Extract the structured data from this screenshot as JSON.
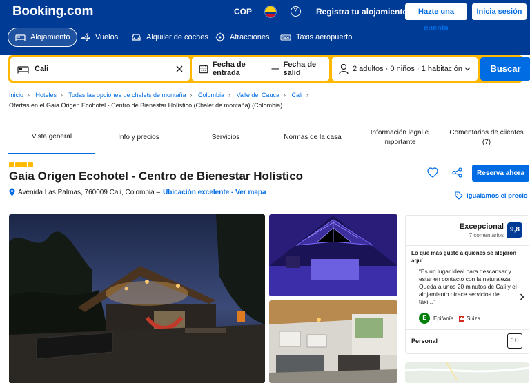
{
  "header": {
    "logo": "Booking.com",
    "currency": "COP",
    "help_symbol": "?",
    "list_property": "Registra tu alojamiento",
    "register": "Hazte una cuenta",
    "signin": "Inicia sesión"
  },
  "nav": [
    {
      "label": "Alojamiento",
      "icon": "bed-icon"
    },
    {
      "label": "Vuelos",
      "icon": "plane-icon"
    },
    {
      "label": "Alquiler de coches",
      "icon": "car-icon"
    },
    {
      "label": "Atracciones",
      "icon": "attractions-icon"
    },
    {
      "label": "Taxis aeropuerto",
      "icon": "taxi-icon"
    }
  ],
  "search": {
    "destination": "Cali",
    "checkin": "Fecha de entrada",
    "dash": "—",
    "checkout": "Fecha de salid",
    "guests": "2 adultos · 0 niños · 1 habitación",
    "button": "Buscar"
  },
  "breadcrumbs": [
    "Inicio",
    "Hoteles",
    "Todas las opciones de chalets de montaña",
    "Colombia",
    "Valle del Cauca",
    "Cali"
  ],
  "breadcrumb_sub": "Ofertas en el Gaia Origen Ecohotel - Centro de Bienestar Holístico (Chalet de montaña) (Colombia)",
  "tabs": [
    {
      "label": "Vista general"
    },
    {
      "label": "Info y precios"
    },
    {
      "label": "Servicios"
    },
    {
      "label": "Normas de la casa"
    },
    {
      "label": "Información legal e importante"
    },
    {
      "label": "Comentarios de clientes (7)"
    }
  ],
  "property": {
    "stars": 4,
    "title": "Gaia Origen Ecohotel - Centro de Bienestar Holístico",
    "address": "Avenida Las Palmas, 760009 Cali, Colombia –",
    "location_link": "Ubicación excelente - Ver mapa",
    "reserve": "Reserva ahora",
    "price_match": "Igualamos el precio"
  },
  "review": {
    "label": "Excepcional",
    "count": "7 comentarios",
    "score": "9,8",
    "liked_heading": "Lo que más gustó a quienes se alojaron aquí",
    "quote": "“Es un lugar ideal para descansar y estar en contacto con la naturaleza. Queda a unos 20 minutos de Cali y el alojamiento ofrece servicios de taxi...”",
    "avatar_initial": "E",
    "reviewer": "Epifanía",
    "country": "Suiza",
    "category": "Personal",
    "category_score": "10"
  },
  "colors": {
    "brand_dark": "#003b95",
    "accent": "#006ce4",
    "search_border": "#ffb700",
    "star": "#febb02"
  }
}
